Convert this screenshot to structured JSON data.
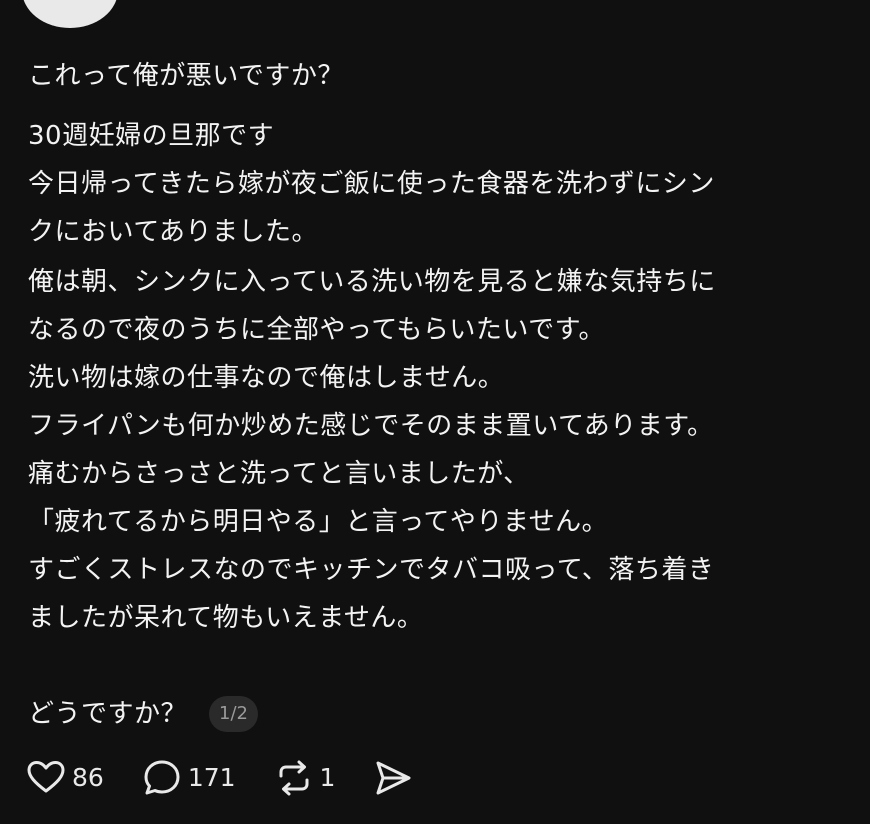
{
  "post": {
    "title": "これって俺が悪いですか？",
    "lines": [
      "30週妊婦の旦那です",
      "今日帰ってきたら嫁が夜ご飯に使った食器を洗わずにシン",
      "クにおいてありました。",
      "俺は朝、シンクに入っている洗い物を見ると嫌な気持ちに",
      "なるので夜のうちに全部やってもらいたいです。",
      "洗い物は嫁の仕事なので俺はしません。",
      "フライパンも何か炒めた感じでそのまま置いてあります。",
      "痛むからさっさと洗ってと言いましたが、",
      "「疲れてるから明日やる」と言ってやりません。",
      "すごくストレスなのでキッチンでタバコ吸って、落ち着き",
      "ましたが呆れて物もいえません。"
    ],
    "closing": "どうですか？",
    "page_indicator": "1/2"
  },
  "actions": {
    "likes": "86",
    "replies": "171",
    "reposts": "1",
    "like_icon": "heart-icon",
    "reply_icon": "comment-icon",
    "repost_icon": "repost-icon",
    "share_icon": "send-icon"
  }
}
